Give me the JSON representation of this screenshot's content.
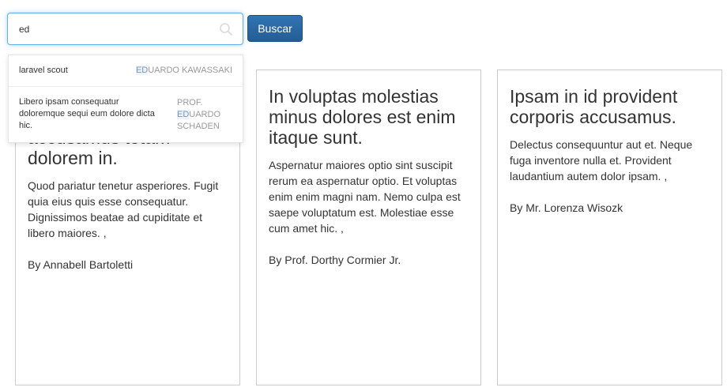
{
  "search": {
    "value": "ed",
    "button_label": "Buscar"
  },
  "suggestions": [
    {
      "title": "laravel scout",
      "author_match": "ED",
      "author_rest": "UARDO KAWASSAKI"
    },
    {
      "title": "Libero ipsam consequatur doloremque sequi eum dolore dicta hic.",
      "author_prefix": "PROF.",
      "author_match": "ED",
      "author_rest": "UARDO SCHADEN"
    }
  ],
  "cards": [
    {
      "title": "accusamus totam dolorem in.",
      "body": "Quod pariatur tenetur asperiores. Fugit quia eius quis esse consequatur. Dignissimos beatae ad cupiditate et libero maiores. ,",
      "author": "By Annabell Bartoletti"
    },
    {
      "title": "In voluptas molestias minus dolores est enim itaque sunt.",
      "body": "Aspernatur maiores optio sint suscipit rerum ea aspernatur optio. Et voluptas enim enim magni nam. Nemo culpa est saepe voluptatum est. Molestiae esse cum amet hic. ,",
      "author": "By Prof. Dorthy Cormier Jr."
    },
    {
      "title": "Ipsam in id provident corporis accusamus.",
      "body": "Delectus consequuntur aut et. Neque fuga inventore nulla et. Provident laudantium autem dolor ipsam. ,",
      "author": "By Mr. Lorenza Wisozk"
    }
  ],
  "colors": {
    "accent": "#2a6ca8",
    "focus_border": "#66afe9",
    "card_border": "#cccccc",
    "highlight_bg": "#eef3f8"
  },
  "icons": {
    "search": "search-icon"
  }
}
